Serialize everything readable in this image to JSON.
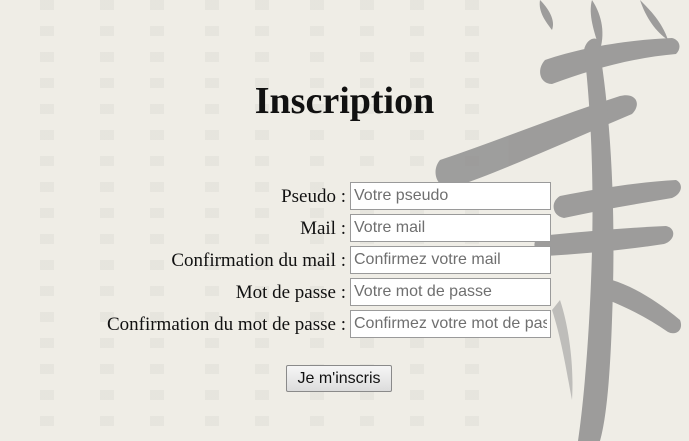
{
  "page": {
    "title": "Inscription"
  },
  "form": {
    "fields": [
      {
        "label": "Pseudo :",
        "placeholder": "Votre pseudo",
        "value": ""
      },
      {
        "label": "Mail :",
        "placeholder": "Votre mail",
        "value": ""
      },
      {
        "label": "Confirmation du mail :",
        "placeholder": "Confirmez votre mail",
        "value": ""
      },
      {
        "label": "Mot de passe :",
        "placeholder": "Votre mot de passe",
        "value": ""
      },
      {
        "label": "Confirmation du mot de passe :",
        "placeholder": "Confirmez votre mot de passe",
        "value": ""
      }
    ],
    "submit_label": "Je m'inscris"
  },
  "background": {
    "paper_color": "#efede6",
    "ink_color": "#8f8f8f",
    "motif": "calligraphy-brush"
  }
}
